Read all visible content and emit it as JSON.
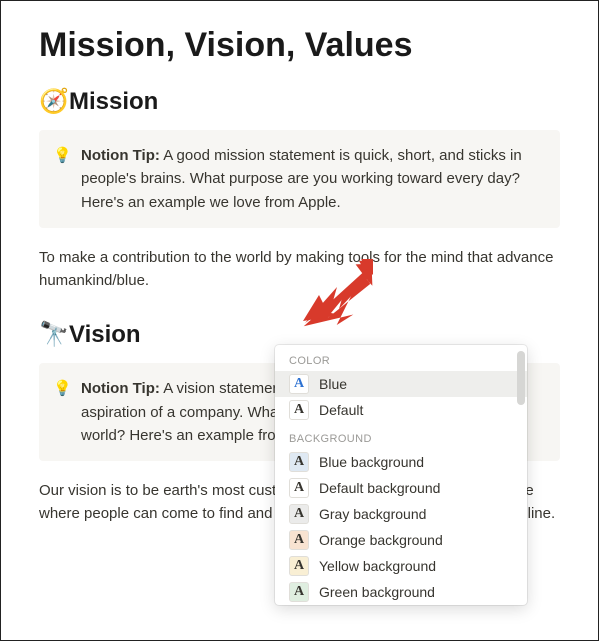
{
  "page": {
    "title": "Mission, Vision, Values"
  },
  "mission": {
    "icon": "🧭",
    "heading": "Mission",
    "tip_label": "Notion Tip:",
    "tip_text": " A good mission statement is quick, short, and sticks in people's brains. What purpose are you working toward every day? Here's an example we love from Apple.",
    "body": "To make a contribution to the world by making tools for the mind that advance humankind/blue."
  },
  "vision": {
    "icon": "🔭",
    "heading": "Vision",
    "tip_label": "Notion Tip:",
    "tip_text": " A vision statement describes the bold, long-term aspiration of a company. What change do you want to make in the world? Here's an example from Amazon.",
    "body": "Our vision is to be earth's most customer-centric company; to build a place where people can come to find and discover anything they want to buy online."
  },
  "popup": {
    "section_color": "COLOR",
    "section_bg": "BACKGROUND",
    "colors": [
      {
        "label": "Blue",
        "letter": "A",
        "fg": "#2e72d2",
        "bg": "#ffffff",
        "selected": true
      },
      {
        "label": "Default",
        "letter": "A",
        "fg": "#37352f",
        "bg": "#ffffff",
        "selected": false
      }
    ],
    "backgrounds": [
      {
        "label": "Blue background",
        "letter": "A",
        "fg": "#37352f",
        "bg": "#dfe9f3"
      },
      {
        "label": "Default background",
        "letter": "A",
        "fg": "#37352f",
        "bg": "#ffffff"
      },
      {
        "label": "Gray background",
        "letter": "A",
        "fg": "#37352f",
        "bg": "#ebebea"
      },
      {
        "label": "Orange background",
        "letter": "A",
        "fg": "#37352f",
        "bg": "#f8e3d1"
      },
      {
        "label": "Yellow background",
        "letter": "A",
        "fg": "#37352f",
        "bg": "#f9efd4"
      },
      {
        "label": "Green background",
        "letter": "A",
        "fg": "#37352f",
        "bg": "#dfeee0"
      }
    ]
  },
  "tip_icon": "💡"
}
